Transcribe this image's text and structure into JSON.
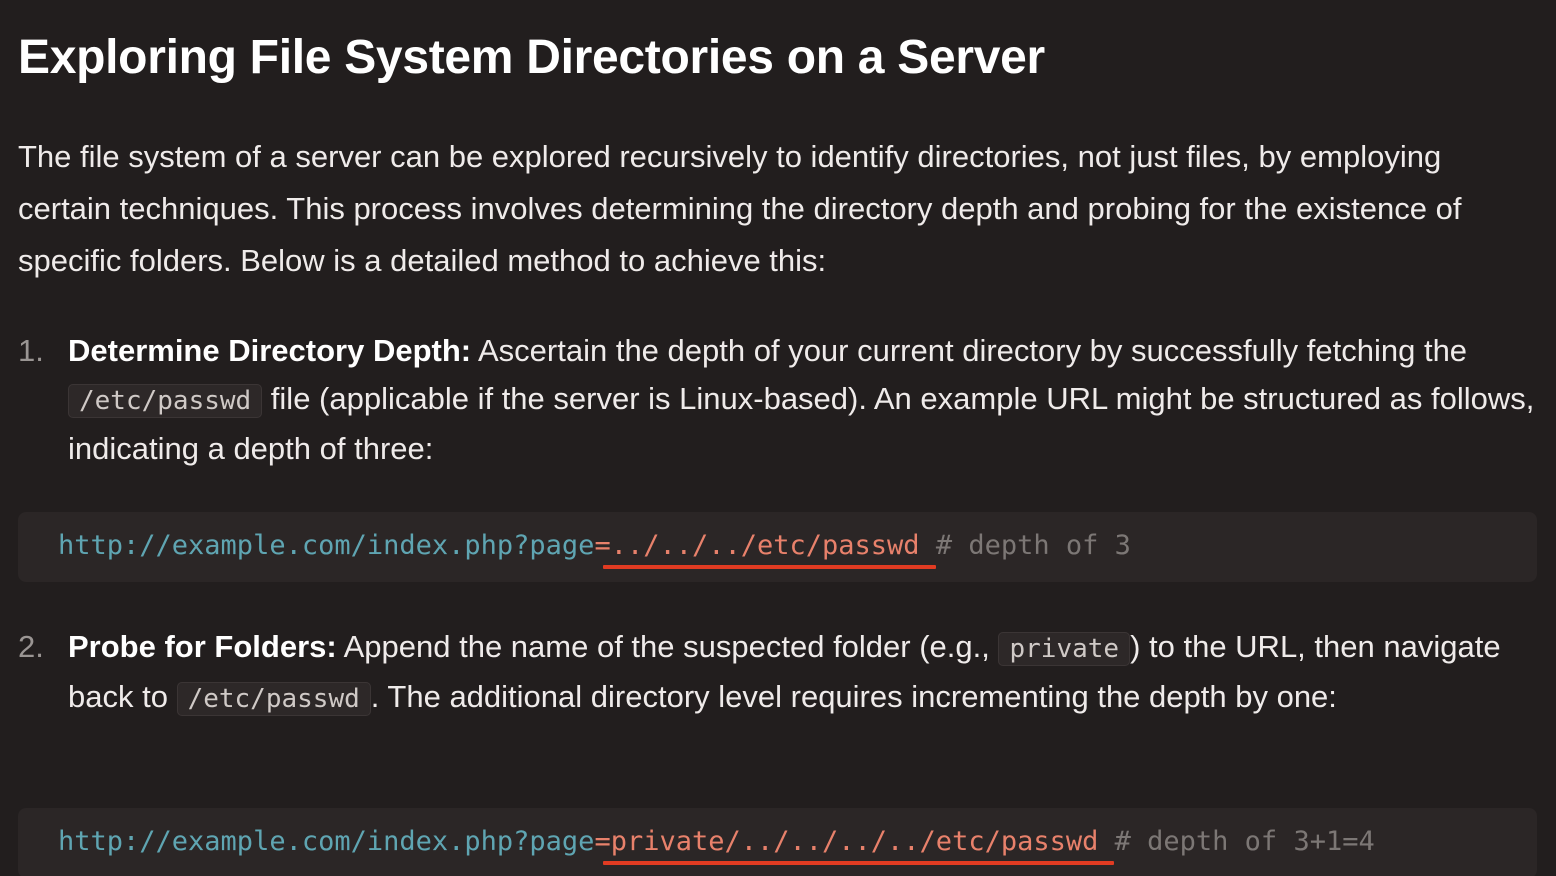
{
  "title": "Exploring File System Directories on a Server",
  "intro": "The file system of a server can be explored recursively to identify directories, not just files, by employing certain techniques. This process involves determining the directory depth and probing for the existence of specific folders. Below is a detailed method to achieve this:",
  "steps": [
    {
      "number": "1.",
      "heading": "Determine Directory Depth:",
      "text_a": " Ascertain the depth of your current directory by successfully fetching the ",
      "code_a": "/etc/passwd",
      "text_b": " file (applicable if the server is Linux-based). An example URL might be structured as follows, indicating a depth of three:",
      "code_block": {
        "url": "http://example.com/index.php?page",
        "eq": "=",
        "path": "../../../etc/passwd",
        "comment": " # depth of 3"
      }
    },
    {
      "number": "2.",
      "heading": "Probe for Folders:",
      "text_a": " Append the name of the suspected folder (e.g., ",
      "code_a": "private",
      "text_b": ") to the URL, then navigate back to ",
      "code_b": "/etc/passwd",
      "text_c": ". The additional directory level requires incrementing the depth by one:",
      "code_block": {
        "url": "http://example.com/index.php?page",
        "eq": "=",
        "path": "private/../../../../etc/passwd",
        "comment": " # depth of 3+1=4"
      }
    }
  ],
  "colors": {
    "background": "#221e1e",
    "code_background": "#2b2626",
    "url": "#5fa5b2",
    "string": "#e8816b",
    "comment": "#7c7775",
    "underline": "#e13b22"
  }
}
